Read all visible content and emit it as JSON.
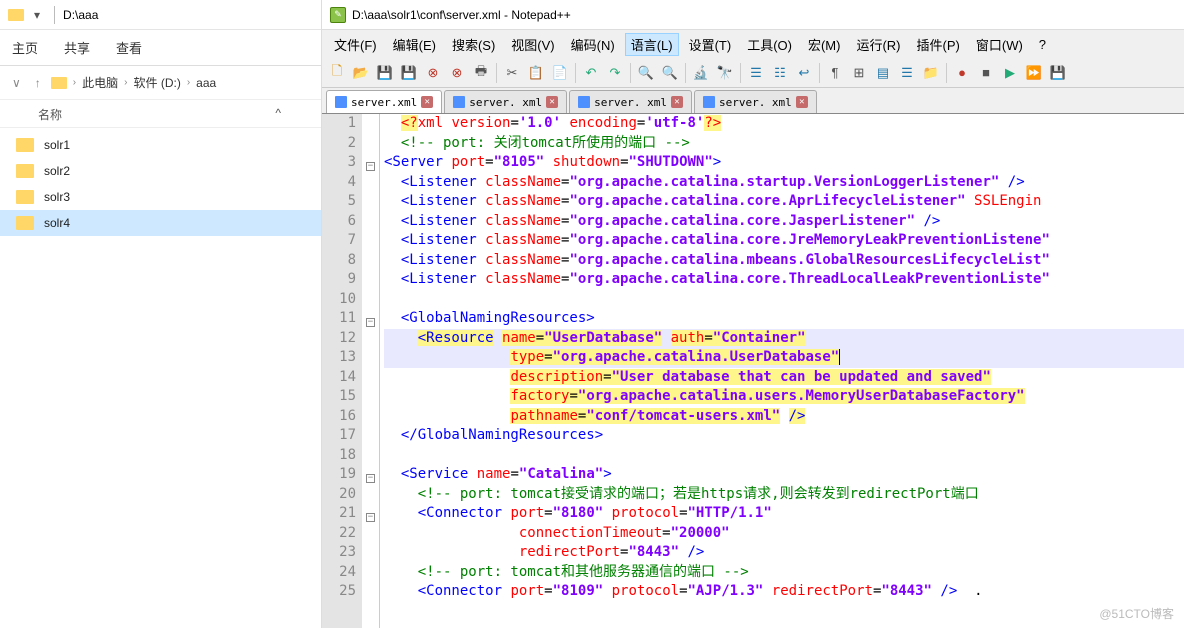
{
  "explorer": {
    "title_path": "D:\\aaa",
    "ribbon": [
      "主页",
      "共享",
      "查看"
    ],
    "crumb": [
      "此电脑",
      "软件 (D:)",
      "aaa"
    ],
    "col_name": "名称",
    "col_sort": "^",
    "items": [
      {
        "name": "solr1"
      },
      {
        "name": "solr2"
      },
      {
        "name": "solr3"
      },
      {
        "name": "solr4"
      }
    ],
    "selected_index": 3
  },
  "npp": {
    "title": "D:\\aaa\\solr1\\conf\\server.xml - Notepad++",
    "menu": [
      {
        "label": "文件(F)"
      },
      {
        "label": "编辑(E)"
      },
      {
        "label": "搜索(S)"
      },
      {
        "label": "视图(V)"
      },
      {
        "label": "编码(N)"
      },
      {
        "label": "语言(L)",
        "hover": true
      },
      {
        "label": "设置(T)"
      },
      {
        "label": "工具(O)"
      },
      {
        "label": "宏(M)"
      },
      {
        "label": "运行(R)"
      },
      {
        "label": "插件(P)"
      },
      {
        "label": "窗口(W)"
      },
      {
        "label": "?"
      }
    ],
    "tabs": [
      {
        "label": "server.xml",
        "active": true
      },
      {
        "label": "server. xml"
      },
      {
        "label": "server. xml"
      },
      {
        "label": "server. xml"
      }
    ],
    "lines": [
      {
        "n": 1,
        "t": "pi",
        "raw": "<?xml version='1.0' encoding='utf-8'?>"
      },
      {
        "n": 2,
        "t": "comm",
        "raw": "<!-- port: 关闭tomcat所使用的端口 -->"
      },
      {
        "n": 3,
        "t": "srv",
        "fold": "-",
        "tag": "Server",
        "attrs": [
          [
            "port",
            "8105"
          ],
          [
            "shutdown",
            "SHUTDOWN"
          ]
        ],
        "selfclose": false
      },
      {
        "n": 4,
        "t": "lis",
        "tag": "Listener",
        "attrs": [
          [
            "className",
            "org.apache.catalina.startup.VersionLoggerListener"
          ]
        ],
        "selfclose": true
      },
      {
        "n": 5,
        "t": "lis",
        "tag": "Listener",
        "attrs": [
          [
            "className",
            "org.apache.catalina.core.AprLifecycleListener"
          ]
        ],
        "tail": " SSLEngin",
        "selfclose": false
      },
      {
        "n": 6,
        "t": "lis",
        "tag": "Listener",
        "attrs": [
          [
            "className",
            "org.apache.catalina.core.JasperListener"
          ]
        ],
        "selfclose": true
      },
      {
        "n": 7,
        "t": "lis",
        "tag": "Listener",
        "attrs": [
          [
            "className",
            "org.apache.catalina.core.JreMemoryLeakPreventionListene"
          ]
        ],
        "selfclose": false
      },
      {
        "n": 8,
        "t": "lis",
        "tag": "Listener",
        "attrs": [
          [
            "className",
            "org.apache.catalina.mbeans.GlobalResourcesLifecycleList"
          ]
        ],
        "selfclose": false
      },
      {
        "n": 9,
        "t": "lis",
        "tag": "Listener",
        "attrs": [
          [
            "className",
            "org.apache.catalina.core.ThreadLocalLeakPreventionListe"
          ]
        ],
        "selfclose": false
      },
      {
        "n": 10,
        "t": "blank"
      },
      {
        "n": 11,
        "t": "gnr-open",
        "fold": "-",
        "tag": "GlobalNamingResources"
      },
      {
        "n": 12,
        "t": "res1",
        "hl": true,
        "tag": "Resource",
        "attrs": [
          [
            "name",
            "UserDatabase"
          ],
          [
            "auth",
            "Container"
          ]
        ]
      },
      {
        "n": 13,
        "t": "res-cont",
        "hl": true,
        "attrs": [
          [
            "type",
            "org.apache.catalina.UserDatabase"
          ]
        ],
        "cursor": true
      },
      {
        "n": 14,
        "t": "res-cont",
        "attrs": [
          [
            "description",
            "User database that can be updated and saved"
          ]
        ]
      },
      {
        "n": 15,
        "t": "res-cont",
        "attrs": [
          [
            "factory",
            "org.apache.catalina.users.MemoryUserDatabaseFactory"
          ]
        ]
      },
      {
        "n": 16,
        "t": "res-cont",
        "attrs": [
          [
            "pathname",
            "conf/tomcat-users.xml"
          ]
        ],
        "selfclose": true
      },
      {
        "n": 17,
        "t": "gnr-close",
        "tag": "GlobalNamingResources"
      },
      {
        "n": 18,
        "t": "blank"
      },
      {
        "n": 19,
        "t": "svc",
        "fold": "-",
        "tag": "Service",
        "attrs": [
          [
            "name",
            "Catalina"
          ]
        ],
        "selfclose": false
      },
      {
        "n": 20,
        "t": "comm2",
        "raw": "<!-- port: tomcat接受请求的端口；若是https请求,则会转发到redirectPort端口"
      },
      {
        "n": 21,
        "t": "conn",
        "fold": "-",
        "tag": "Connector",
        "attrs": [
          [
            "port",
            "8180"
          ],
          [
            "protocol",
            "HTTP/1.1"
          ]
        ]
      },
      {
        "n": 22,
        "t": "conn-cont",
        "attrs": [
          [
            "connectionTimeout",
            "20000"
          ]
        ]
      },
      {
        "n": 23,
        "t": "conn-cont",
        "attrs": [
          [
            "redirectPort",
            "8443"
          ]
        ],
        "selfclose": true
      },
      {
        "n": 24,
        "t": "comm3",
        "raw": "<!-- port: tomcat和其他服务器通信的端口 -->"
      },
      {
        "n": 25,
        "t": "conn2",
        "tag": "Connector",
        "attrs": [
          [
            "port",
            "8109"
          ],
          [
            "protocol",
            "AJP/1.3"
          ],
          [
            "redirectPort",
            "8443"
          ]
        ],
        "selfclose": true,
        "tail2": "  ."
      }
    ]
  },
  "watermark": "@51CTO博客"
}
